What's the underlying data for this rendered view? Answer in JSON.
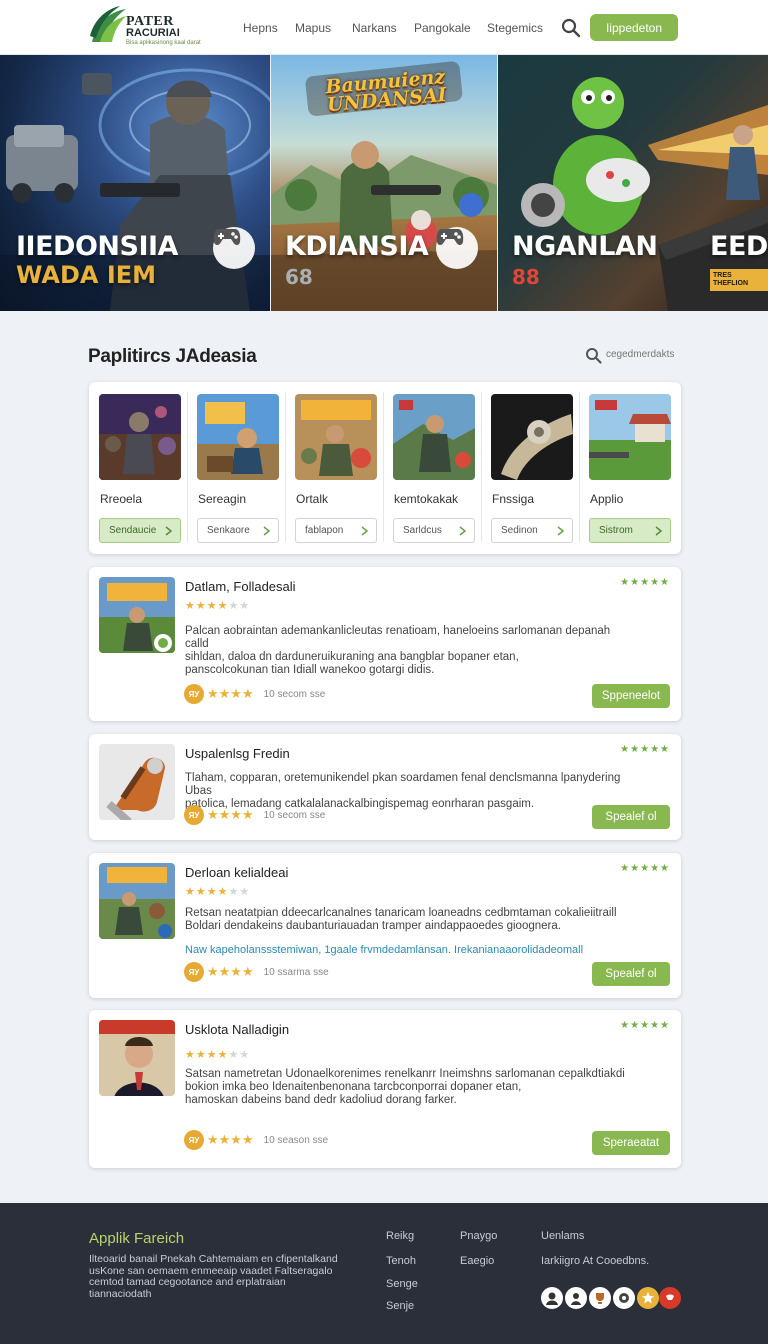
{
  "brand": {
    "line1": "PATER",
    "line2": "RACURIAI",
    "tagline": "Bisa aplikasinong kaal darat"
  },
  "nav": {
    "items": [
      "Hepns",
      "Mapus",
      "Narkans",
      "Pangokale",
      "Stegemics"
    ],
    "cta_label": "Iippedeton"
  },
  "hero": {
    "panels": [
      {
        "title": "IIEDONSIIA",
        "subtitle": "WADA IEM",
        "number": ""
      },
      {
        "title": "KDIANSIA",
        "subtitle": "",
        "number": "68",
        "banner": "Baumuienz UNDANSAI"
      },
      {
        "title": "NGANLAN",
        "subtitle": "",
        "number": "88",
        "extra_title": "EEDA",
        "extra_tag": "TRES THEFLION"
      }
    ]
  },
  "section": {
    "title": "Paplitircs JAdeasia",
    "search_placeholder": "cegedmerdakts"
  },
  "games": [
    {
      "name": "Rreoela",
      "button": "Sendaucie",
      "selected": true
    },
    {
      "name": "Sereagin",
      "button": "Senkaore",
      "selected": false
    },
    {
      "name": "Ortalk",
      "button": "fablapon",
      "selected": false
    },
    {
      "name": "kemtokakak",
      "button": "Sarldcus",
      "selected": false
    },
    {
      "name": "Fnssiga",
      "button": "Sedinon",
      "selected": false
    },
    {
      "name": "Applio",
      "button": "Sistrom",
      "selected": true
    }
  ],
  "apps": [
    {
      "title": "Datlam, Folladesali",
      "desc": [
        "Palcan aobraintan ademankanlicleutas renatioam,  haneloeins sarlomanan depanah calld",
        "sihldan, daloa dn darduneruikuraning ana bangblar bopaner etan,",
        "panscolcokunan tian Idiall wanekoo gotargi didis."
      ],
      "link": "",
      "count": "10 secom sse",
      "badge": "ЯУ",
      "button": "Sppeneelot"
    },
    {
      "title": "Uspalenlsg Fredin",
      "desc": [
        "Tlaham, copparan, oretemunikendel pkan soardamen fenal denclsmanna lpanydering Ubas",
        "patolica, lemadang catkalalanackalbingispemag eonrharan pasgaim."
      ],
      "link": "",
      "count": "10 secom sse",
      "badge": "ЯУ",
      "button": "Spealef ol"
    },
    {
      "title": "Derloan kelialdeai",
      "desc": [
        "Retsan  neatatpian ddeecarlcanalnes tanaricam  loaneadns cedbmtaman cokalieiitraill",
        "Boldari dendakeins daubanturiauadan tramper aindappaoedes gioognera."
      ],
      "link": "Naw kapeholanssstemiwan,   1gaale frvmdedamlansan.   Irekanianaaorolidadeomall",
      "count": "10 ssarma sse",
      "badge": "ЯУ",
      "button": "Spealef ol"
    },
    {
      "title": "Usklota Nalladigin",
      "desc": [
        "Satsan  nametretan Udonaelkorenimes renelkanrr Ineimshns sarlomanan cepalkdtiakdi",
        "bokion  imka beo Idenaitenbenonana tarcbconporrai dopaner etan,",
        "hamoskan dabeins band dedr kadoliud dorang farker."
      ],
      "link": "",
      "count": "10 season sse",
      "badge": "ЯУ",
      "button": "Speraeatat"
    }
  ],
  "footer": {
    "title": "Applik Fareich",
    "desc": "Ilteoarid banail Pnekah Cahtemaiam en cfipentalkand usKone san oemaem enmeeaip vaadet Faltseragalo cemtod tamad cegootance and erplatraian tiannaciodath",
    "col1": [
      "Reikg",
      "Tenoh",
      "Senge",
      "Senje"
    ],
    "col2": [
      "Pnaygo",
      "Eaegio"
    ],
    "col3": [
      "Uenlams",
      "Iarkiigro At Cooedbns."
    ]
  },
  "colors": {
    "accent": "#8ab850",
    "star": "#e9b23b",
    "footer": "#2b2f3a"
  }
}
